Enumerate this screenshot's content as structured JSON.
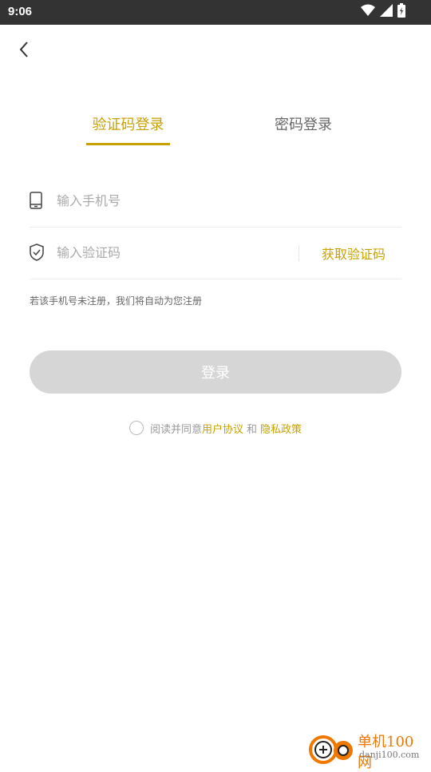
{
  "status_bar": {
    "time": "9:06",
    "icons": [
      "wifi-icon",
      "signal-icon",
      "battery-icon"
    ]
  },
  "nav": {
    "back_icon": "chevron-left-icon"
  },
  "tabs": [
    {
      "label": "验证码登录",
      "active": true
    },
    {
      "label": "密码登录",
      "active": false
    }
  ],
  "form": {
    "phone": {
      "icon": "phone-icon",
      "placeholder": "输入手机号",
      "value": ""
    },
    "code": {
      "icon": "shield-check-icon",
      "placeholder": "输入验证码",
      "value": "",
      "get_code_label": "获取验证码"
    },
    "hint": "若该手机号未注册，我们将自动为您注册",
    "submit_label": "登录"
  },
  "agreement": {
    "checked": false,
    "prefix": "阅读并同意",
    "user_agreement": "用户协议",
    "and": "和",
    "privacy_policy": "隐私政策"
  },
  "watermark": {
    "main": "单机100网",
    "sub": "danji100.com"
  },
  "colors": {
    "accent": "#c9a100",
    "status_bar": "#333333",
    "button_disabled": "#d6d6d6"
  }
}
